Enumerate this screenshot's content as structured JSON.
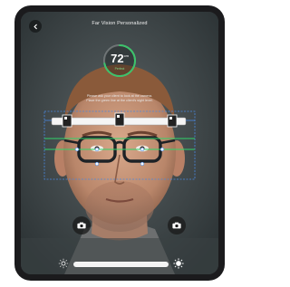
{
  "header": {
    "title": "Far Vision Personalized"
  },
  "gauge": {
    "value": "72",
    "unit": "cm",
    "status": "Perfect",
    "fraction": 0.72,
    "color": "#3cc36b"
  },
  "instructions": {
    "line1": "Please ask your client to look at the camera.",
    "line2": "Place the green line at the client's sight level."
  },
  "colors": {
    "guide_green": "#2fd46a",
    "frame_blue": "#4a88e0",
    "accent_white": "#ffffff"
  },
  "icons": {
    "back": "chevron-left-icon",
    "camera_left": "camera-icon",
    "camera_right": "camera-icon",
    "brightness_low": "sun-icon",
    "brightness_high": "sun-icon"
  },
  "brightness": {
    "level": 0.5
  }
}
